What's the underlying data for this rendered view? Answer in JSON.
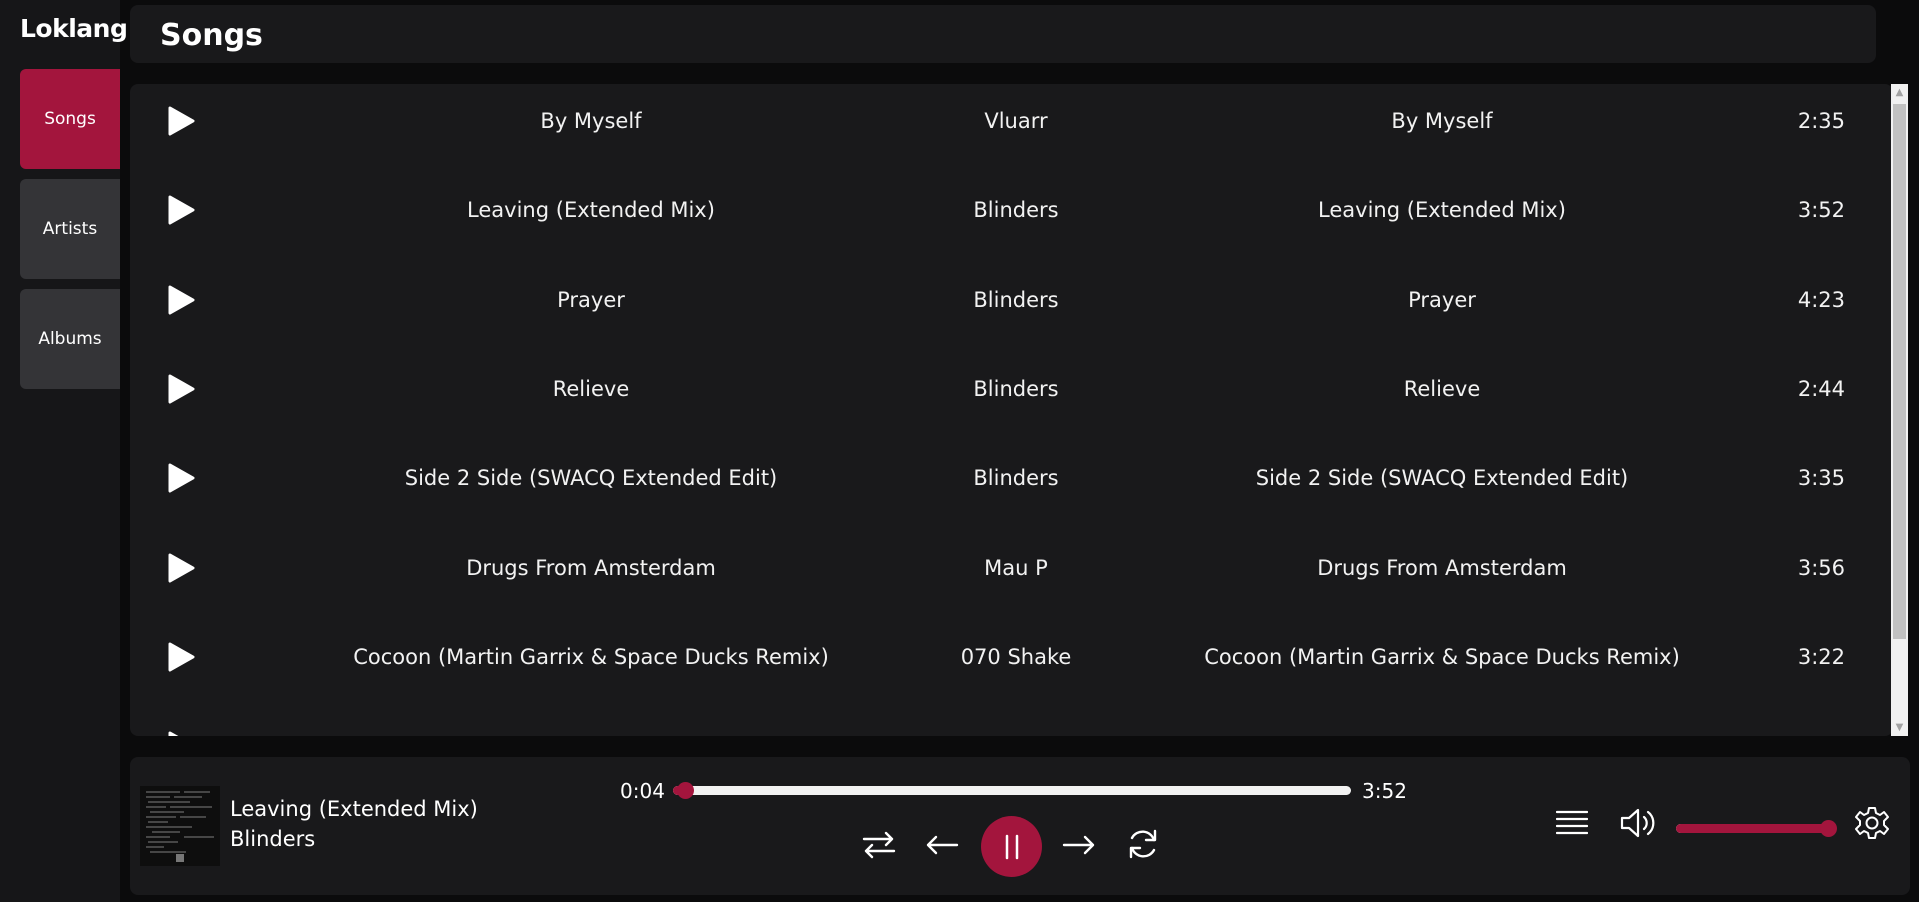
{
  "app": {
    "title": "Loklang"
  },
  "sidebar": {
    "items": [
      {
        "label": "Songs",
        "active": true
      },
      {
        "label": "Artists",
        "active": false
      },
      {
        "label": "Albums",
        "active": false
      }
    ]
  },
  "header": {
    "title": "Songs"
  },
  "songs": [
    {
      "title": "By Myself",
      "artist": "Vluarr",
      "album": "By Myself",
      "duration": "2:35"
    },
    {
      "title": "Leaving (Extended Mix)",
      "artist": "Blinders",
      "album": "Leaving (Extended Mix)",
      "duration": "3:52"
    },
    {
      "title": "Prayer",
      "artist": "Blinders",
      "album": "Prayer",
      "duration": "4:23"
    },
    {
      "title": "Relieve",
      "artist": "Blinders",
      "album": "Relieve",
      "duration": "2:44"
    },
    {
      "title": "Side 2 Side (SWACQ Extended Edit)",
      "artist": "Blinders",
      "album": "Side 2 Side (SWACQ Extended Edit)",
      "duration": "3:35"
    },
    {
      "title": "Drugs From Amsterdam",
      "artist": "Mau P",
      "album": "Drugs From Amsterdam",
      "duration": "3:56"
    },
    {
      "title": "Cocoon (Martin Garrix & Space Ducks Remix)",
      "artist": "070 Shake",
      "album": "Cocoon (Martin Garrix & Space Ducks Remix)",
      "duration": "3:22"
    }
  ],
  "player": {
    "track_title": "Leaving (Extended Mix)",
    "track_artist": "Blinders",
    "current_time": "0:04",
    "total_time": "3:52",
    "progress_fraction": 0.017,
    "volume_fraction": 0.95,
    "state": "playing"
  },
  "colors": {
    "accent": "#a3153d",
    "panel": "#19191b",
    "background": "#0b0b0c",
    "nav_inactive": "#343437"
  },
  "icons": {
    "row_play": "play-icon",
    "shuffle": "shuffle-icon",
    "previous": "arrow-left-icon",
    "pause": "pause-icon",
    "next": "arrow-right-icon",
    "repeat": "repeat-icon",
    "queue": "queue-icon",
    "volume": "volume-icon",
    "settings": "gear-icon"
  }
}
